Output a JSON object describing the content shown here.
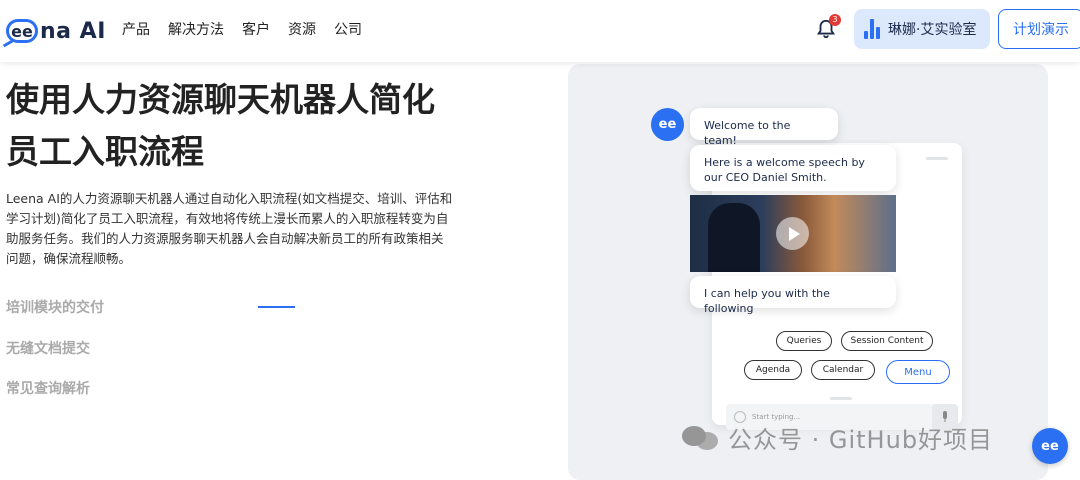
{
  "brand": {
    "logo_mark": "ee",
    "logo_word": "na AI",
    "accent": "#2b6ff2"
  },
  "nav": {
    "items": [
      "产品",
      "解决方法",
      "客户",
      "资源",
      "公司"
    ]
  },
  "header": {
    "notification_count": "3",
    "lab_label": "琳娜·艾实验室",
    "demo_label": "计划演示"
  },
  "hero": {
    "title": "使用人力资源聊天机器人简化员工入职流程",
    "description": "Leena AI的人力资源聊天机器人通过自动化入职流程(如文档提交、培训、评估和学习计划)简化了员工入职流程，有效地将传统上漫长而累人的入职旅程转变为自助服务任务。我们的人力资源服务聊天机器人会自动解决新员工的所有政策相关问题，确保流程顺畅。"
  },
  "accordion": {
    "items": [
      "培训模块的交付",
      "无缝文档提交",
      "常见查询解析"
    ],
    "active_index": 0
  },
  "chat": {
    "avatar": "ee",
    "messages": [
      "Welcome to the team!",
      "Here is a welcome speech by our CEO Daniel Smith.",
      "I can help you with the following"
    ],
    "chips": [
      "Queries",
      "Session Content",
      "Agenda",
      "Calendar",
      "Menu"
    ],
    "input_placeholder": "Start typing..."
  },
  "watermark": {
    "text": "公众号 · GitHub好项目"
  },
  "float_button": {
    "label": "ee"
  }
}
